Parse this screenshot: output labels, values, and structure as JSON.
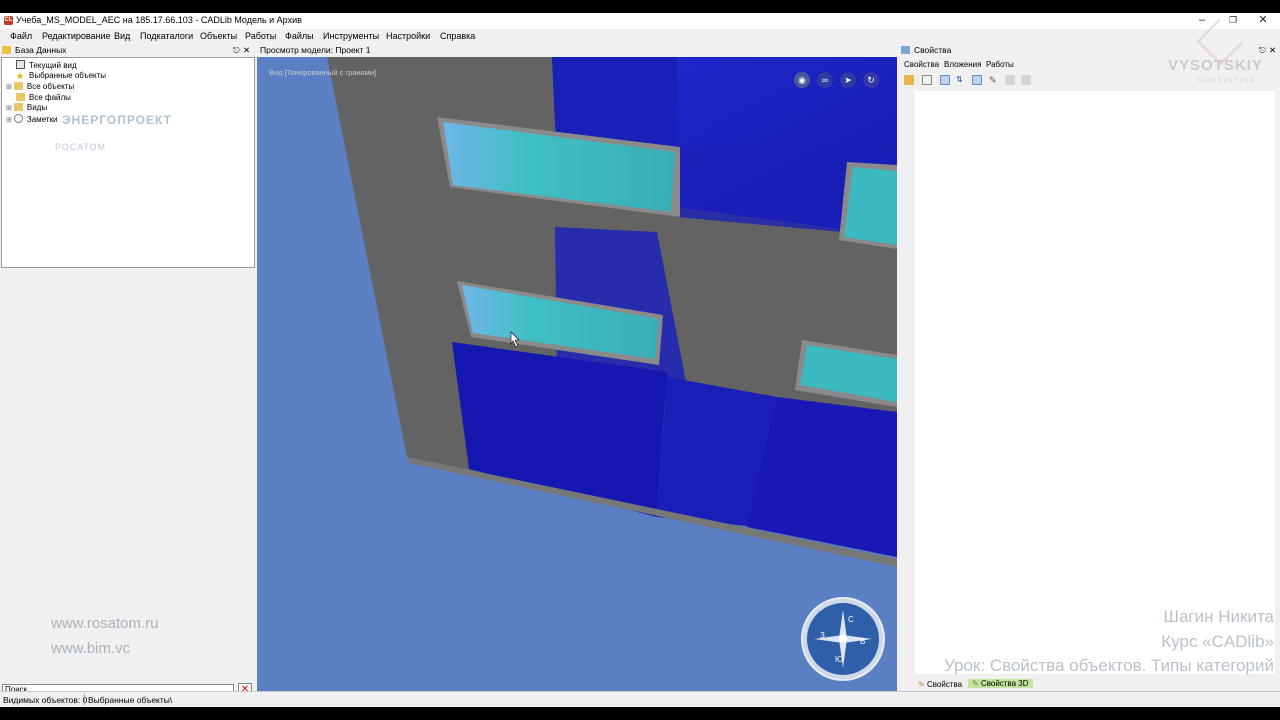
{
  "window": {
    "title": "Учеба_MS_MODEL_AEC на 185.17.66.103 - CADLib Модель и Архив",
    "app_icon": "CL",
    "controls": [
      "minimize-icon",
      "restore-icon",
      "close-icon"
    ]
  },
  "menu": [
    "Файл",
    "Редактирование",
    "Вид",
    "Подкаталоги",
    "Объекты",
    "Работы",
    "Файлы",
    "Инструменты",
    "Настройки",
    "Справка"
  ],
  "left_panel": {
    "title": "База Данных",
    "tree": [
      {
        "label": "Текущий вид",
        "icon": "view-icon"
      },
      {
        "label": "Выбранные объекты",
        "icon": "star-icon"
      },
      {
        "label": "Все объекты",
        "icon": "folder-icon",
        "expandable": true
      },
      {
        "label": "Все файлы",
        "icon": "folder-icon"
      },
      {
        "label": "Виды",
        "icon": "folder-icon",
        "expandable": true
      },
      {
        "label": "Заметки",
        "icon": "note-icon",
        "expandable": true
      }
    ],
    "watermark": {
      "brand": "ЭНЕРГОПРОЕКТ",
      "sub": "РОСАТОМ"
    },
    "urls": [
      "www.rosatom.ru",
      "www.bim.vc"
    ],
    "search": {
      "placeholder": "Поиск...",
      "value": "Поиск..."
    }
  },
  "viewport": {
    "title": "Просмотр модели: Проект 1",
    "mode_label": "Вид [Тонированный с гранями]",
    "nav_buttons": [
      "eye-icon",
      "walk-icon",
      "fly-icon",
      "orbit-icon"
    ],
    "compass": {
      "north": "С",
      "east": "В",
      "south": "Ю",
      "west": "З"
    }
  },
  "right_panel": {
    "title": "Свойства",
    "tabs": [
      "Свойства",
      "Вложения",
      "Работы"
    ],
    "bottom_tabs": [
      "Свойства",
      "Свойства 3D"
    ],
    "brand": "VYSOTSKIY",
    "brand_sub": "CONSULTING"
  },
  "credits": {
    "author": "Шагин Никита",
    "course": "Курс «CADlib»",
    "lesson": "Урок: Свойства объектов. Типы категорий"
  },
  "status": {
    "visible_objects": "Видимых объектов: 0",
    "path": "Выбранные объекты\\"
  },
  "colors": {
    "sky": "#1a23c0",
    "ground": "#5b7fc3",
    "wall": "#636363",
    "glass": "#3bb8c0",
    "panel": "#f0f0f0"
  }
}
